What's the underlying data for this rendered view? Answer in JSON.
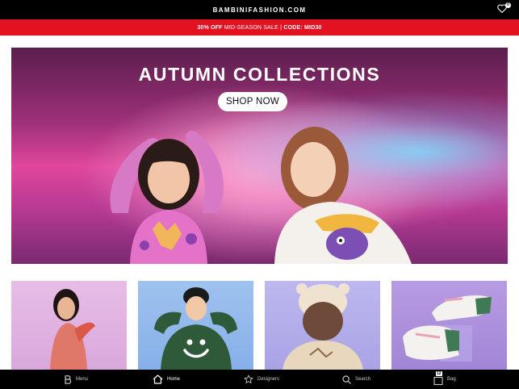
{
  "header": {
    "brand": "BAMBINIFASHION.COM",
    "wishlist_count": "0"
  },
  "promo": {
    "highlight": "30% OFF",
    "text": " MID-SEASON SALE | ",
    "code": "CODE: MID30"
  },
  "hero": {
    "title": "AUTUMN COLLECTIONS",
    "cta": "SHOP NOW"
  },
  "nav": {
    "items": [
      {
        "label": "Menu",
        "icon": "b-logo-icon"
      },
      {
        "label": "Home",
        "icon": "home-icon"
      },
      {
        "label": "Designers",
        "icon": "star-icon"
      },
      {
        "label": "Search",
        "icon": "search-icon"
      },
      {
        "label": "Bag",
        "icon": "bag-icon",
        "count": "12"
      }
    ]
  },
  "colors": {
    "topbar": "#000000",
    "promo": "#e31221",
    "navbar": "#000000"
  }
}
